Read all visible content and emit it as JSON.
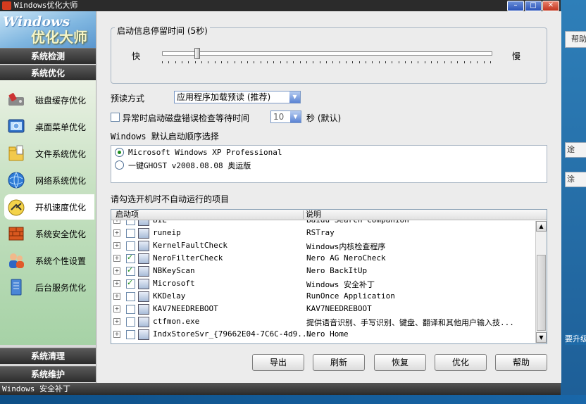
{
  "window": {
    "title": "Windows优化大师"
  },
  "logo": {
    "line1": "Windows",
    "line2": "优化大师"
  },
  "sidebar": {
    "sections": [
      {
        "label": "系统检测"
      },
      {
        "label": "系统优化"
      },
      {
        "label": "系统清理"
      },
      {
        "label": "系统维护"
      }
    ],
    "items": [
      {
        "label": "磁盘缓存优化",
        "icon": "disk-cache-icon"
      },
      {
        "label": "桌面菜单优化",
        "icon": "desktop-menu-icon"
      },
      {
        "label": "文件系统优化",
        "icon": "file-system-icon"
      },
      {
        "label": "网络系统优化",
        "icon": "network-icon"
      },
      {
        "label": "开机速度优化",
        "icon": "boot-speed-icon"
      },
      {
        "label": "系统安全优化",
        "icon": "security-icon"
      },
      {
        "label": "系统个性设置",
        "icon": "personalize-icon"
      },
      {
        "label": "后台服务优化",
        "icon": "services-icon"
      }
    ],
    "active_index": 4
  },
  "boot_delay": {
    "legend": "启动信息停留时间 (5秒)",
    "fast_label": "快",
    "slow_label": "慢",
    "value_fraction": 0.1
  },
  "prefetch": {
    "label": "预读方式",
    "value": "应用程序加载预读 (推荐)"
  },
  "diskcheck": {
    "label": "异常时启动磁盘错误检查等待时间",
    "value": "10",
    "suffix": "秒 (默认)"
  },
  "os_order": {
    "label": "Windows 默认启动顺序选择",
    "options": [
      {
        "label": "Microsoft Windows XP Professional",
        "selected": true
      },
      {
        "label": "一键GHOST v2008.08.08 奥运版",
        "selected": false
      }
    ]
  },
  "startup": {
    "label": "请勾选开机时不自动运行的项目",
    "columns": [
      "启动项",
      "说明"
    ],
    "rows": [
      {
        "name": "BIE",
        "desc": "Baidu Search Companion",
        "checked": false
      },
      {
        "name": "runeip",
        "desc": "RSTray",
        "checked": false
      },
      {
        "name": "KernelFaultCheck",
        "desc": "Windows内核检查程序",
        "checked": false
      },
      {
        "name": "NeroFilterCheck",
        "desc": "Nero AG NeroCheck",
        "checked": true
      },
      {
        "name": "NBKeyScan",
        "desc": "Nero BackItUp",
        "checked": true
      },
      {
        "name": "Microsoft",
        "desc": "Windows 安全补丁",
        "checked": true
      },
      {
        "name": "KKDelay",
        "desc": "RunOnce Application",
        "checked": false
      },
      {
        "name": "KAV7NEEDREBOOT",
        "desc": "KAV7NEEDREBOOT",
        "checked": false
      },
      {
        "name": "ctfmon.exe",
        "desc": "提供语音识别、手写识别、键盘、翻译和其他用户输入技...",
        "checked": false
      },
      {
        "name": "IndxStoreSvr_{79662E04-7C6C-4d9...",
        "desc": "Nero Home",
        "checked": false
      }
    ]
  },
  "buttons": {
    "export": "导出",
    "refresh": "刷新",
    "restore": "恢复",
    "optimize": "优化",
    "help": "帮助"
  },
  "status": {
    "text": "Windows 安全补丁"
  },
  "background": {
    "help_text": "帮助",
    "frag1": "途",
    "frag2": "涂",
    "frag3": "要升级"
  }
}
